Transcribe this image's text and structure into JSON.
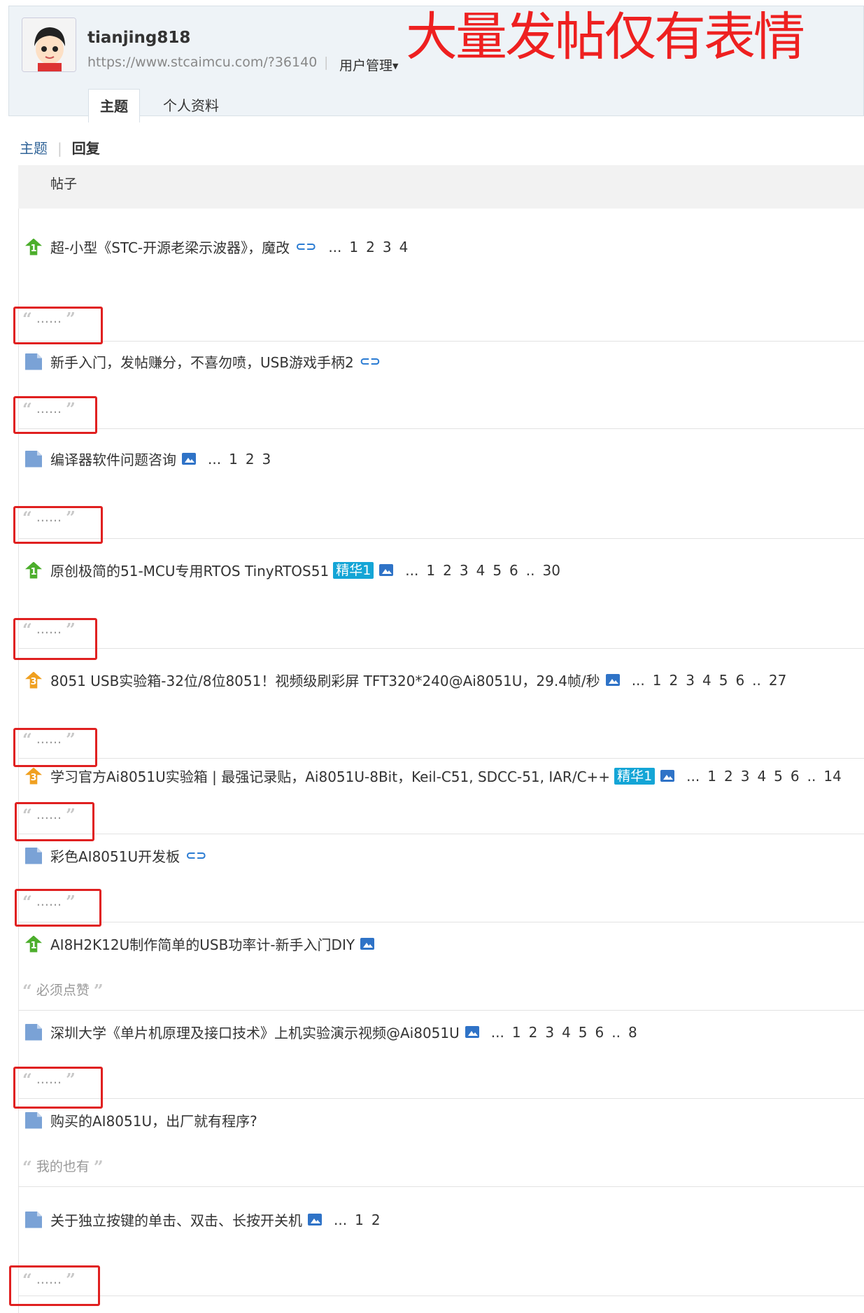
{
  "profile": {
    "username": "tianjing818",
    "url": "https://www.stcaimcu.com/?36140",
    "separator": "|",
    "manage_label": "用户管理"
  },
  "annotation": "大量发帖仅有表情",
  "tabs": {
    "topics": "主题",
    "profile": "个人资料"
  },
  "subtabs": {
    "topics": "主题",
    "separator": "|",
    "replies": "回复"
  },
  "column_header": "帖子",
  "quote_open": "“",
  "quote_close": "”",
  "posts": [
    {
      "icon": "hot1",
      "title": "超-小型《STC-开源老梁示波器》，魔改",
      "attachment": "attachment-icon",
      "pages": [
        "1",
        "2",
        "3",
        "4"
      ],
      "reply": "......",
      "flagged": true
    },
    {
      "icon": "doc",
      "title": "新手入门，发帖赚分，不喜勿喷，USB游戏手柄2",
      "attachment": "attachment-icon",
      "pages": [],
      "reply": "......",
      "flagged": true
    },
    {
      "icon": "doc",
      "title": "编译器软件问题咨询",
      "attachment": "image-icon",
      "pages": [
        "1",
        "2",
        "3"
      ],
      "reply": "......",
      "flagged": true
    },
    {
      "icon": "hot1",
      "title": "原创极简的51-MCU专用RTOS TinyRTOS51",
      "badge": "精华1",
      "attachment": "image-icon",
      "pages": [
        "1",
        "2",
        "3",
        "4",
        "5",
        "6",
        "..",
        "30"
      ],
      "reply": "......",
      "flagged": true
    },
    {
      "icon": "hot3",
      "title": "8051 USB实验箱-32位/8位8051！视频级刷彩屏 TFT320*240@Ai8051U，29.4帧/秒",
      "attachment": "image-icon",
      "pages": [
        "1",
        "2",
        "3",
        "4",
        "5",
        "6",
        "..",
        "27"
      ],
      "reply": "......",
      "flagged": true
    },
    {
      "icon": "hot3",
      "title": "学习官方Ai8051U实验箱 | 最强记录贴，Ai8051U-8Bit，Keil-C51, SDCC-51, IAR/C++",
      "badge": "精华1",
      "attachment": "image-icon",
      "pages": [
        "1",
        "2",
        "3",
        "4",
        "5",
        "6",
        "..",
        "14"
      ],
      "reply": "......",
      "flagged": true
    },
    {
      "icon": "doc",
      "title": "彩色AI8051U开发板",
      "attachment": "attachment-icon",
      "pages": [],
      "reply": "......",
      "flagged": true
    },
    {
      "icon": "hot1",
      "title": "AI8H2K12U制作简单的USB功率计-新手入门DIY",
      "attachment": "image-icon",
      "pages": [],
      "reply": "必须点赞",
      "flagged": false
    },
    {
      "icon": "doc",
      "title": "深圳大学《单片机原理及接口技术》上机实验演示视频@Ai8051U",
      "attachment": "image-icon",
      "pages": [
        "1",
        "2",
        "3",
        "4",
        "5",
        "6",
        "..",
        "8"
      ],
      "reply": "......",
      "flagged": true
    },
    {
      "icon": "doc",
      "title": "购买的AI8051U，出厂就有程序?",
      "pages": [],
      "reply": "我的也有",
      "flagged": false
    },
    {
      "icon": "doc",
      "title": "关于独立按键的单击、双击、长按开关机",
      "attachment": "image-icon",
      "pages": [
        "1",
        "2"
      ],
      "reply": "......",
      "flagged": true
    }
  ]
}
